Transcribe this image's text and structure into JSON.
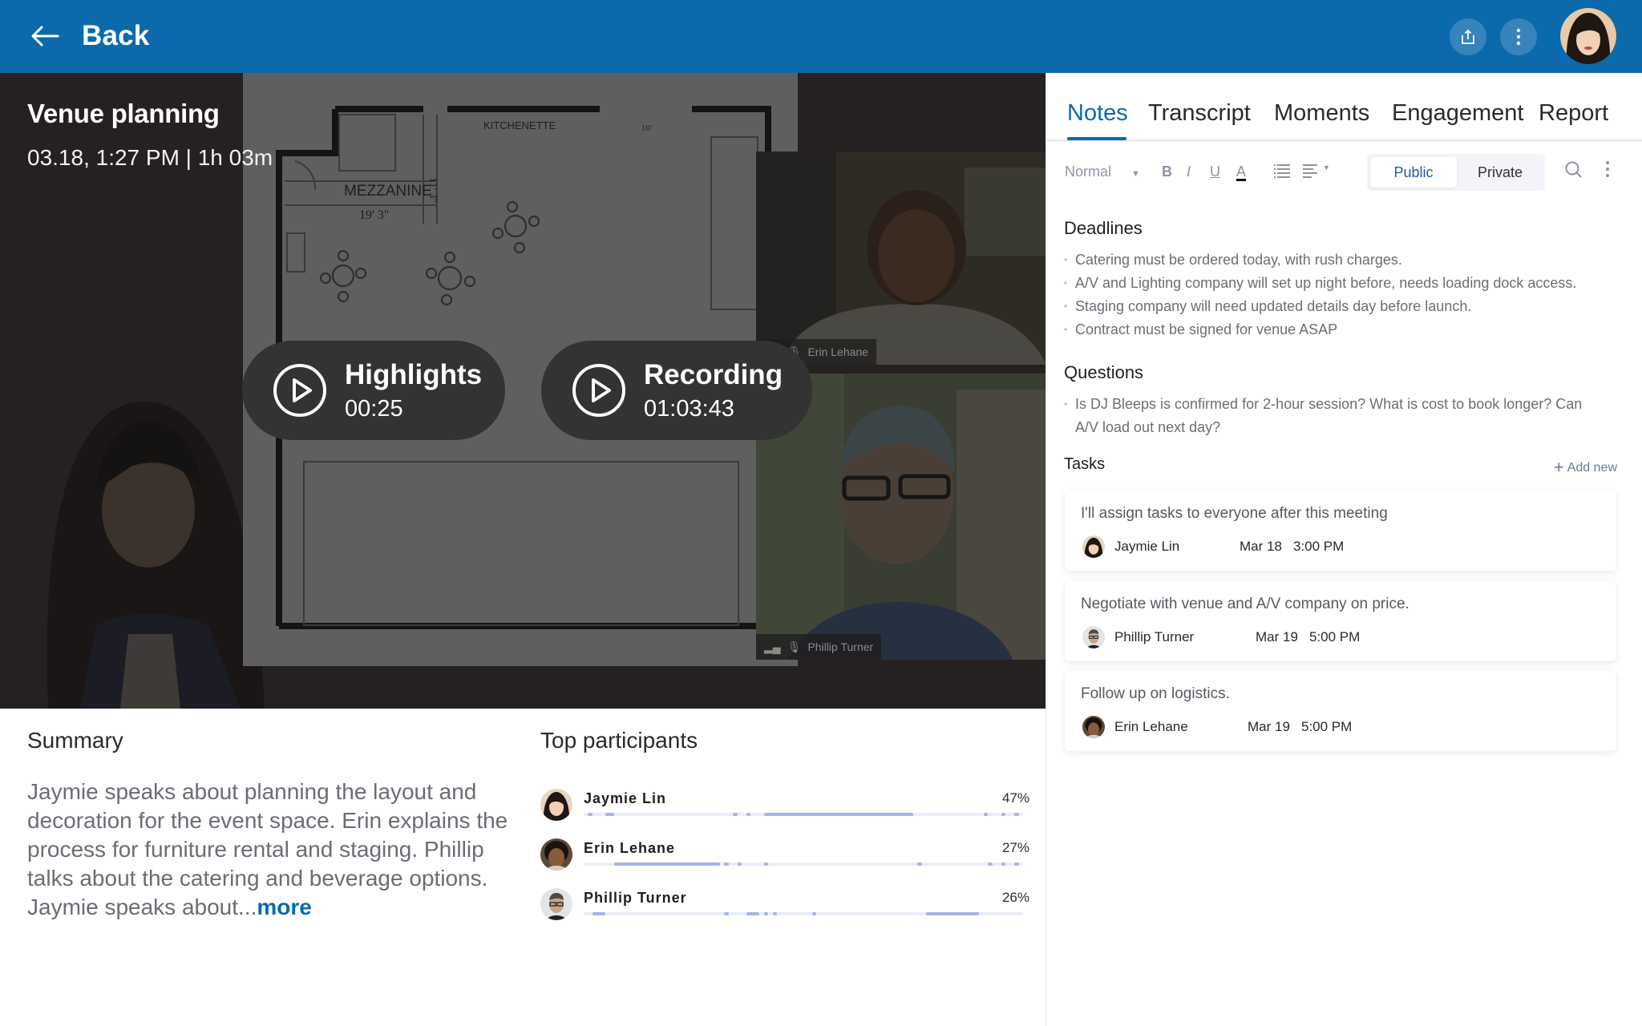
{
  "header": {
    "back_label": "Back",
    "brand_color": "#0a6aab",
    "actions": [
      {
        "icon": "share-icon"
      },
      {
        "icon": "more-vertical-icon"
      }
    ],
    "user_avatar": "user-avatar"
  },
  "meeting": {
    "title": "Venue planning",
    "subtitle": "03.18, 1:27 PM | 1h 03m",
    "highlights": {
      "label": "Highlights",
      "duration": "00:25"
    },
    "recording": {
      "label": "Recording",
      "duration": "01:03:43"
    },
    "floor_plan_labels": {
      "kitchenette": "KITCHENETTE",
      "mezzanine": "MEZZANINE",
      "width_dim": "19' 3\"",
      "height_dim": "11' 3\"",
      "ten_ft": "10'"
    },
    "video_tiles": [
      {
        "name": "Erin Lehane"
      },
      {
        "name": "Phillip Turner"
      }
    ]
  },
  "summary": {
    "heading": "Summary",
    "text": "Jaymie speaks about planning the layout and decoration for the event space. Erin explains the process for furniture rental and staging. Phillip talks about the catering and beverage options. Jaymie speaks about...",
    "more_label": "more"
  },
  "participants": {
    "heading": "Top participants",
    "items": [
      {
        "name": "Jaymie Lin",
        "percent": "47%",
        "share": 0.47,
        "segments": [
          [
            0.01,
            0.02
          ],
          [
            0.05,
            0.07
          ],
          [
            0.34,
            0.35
          ],
          [
            0.37,
            0.38
          ],
          [
            0.41,
            0.75
          ],
          [
            0.91,
            0.92
          ],
          [
            0.95,
            0.96
          ],
          [
            0.98,
            0.99
          ]
        ]
      },
      {
        "name": "Erin Lehane",
        "percent": "27%",
        "share": 0.27,
        "segments": [
          [
            0.07,
            0.31
          ],
          [
            0.32,
            0.33
          ],
          [
            0.35,
            0.36
          ],
          [
            0.41,
            0.42
          ],
          [
            0.76,
            0.77
          ],
          [
            0.92,
            0.93
          ],
          [
            0.95,
            0.96
          ],
          [
            0.98,
            0.99
          ]
        ]
      },
      {
        "name": "Phillip Turner",
        "percent": "26%",
        "share": 0.26,
        "segments": [
          [
            0.02,
            0.05
          ],
          [
            0.32,
            0.33
          ],
          [
            0.37,
            0.4
          ],
          [
            0.41,
            0.42
          ],
          [
            0.43,
            0.44
          ],
          [
            0.52,
            0.53
          ],
          [
            0.78,
            0.9
          ]
        ]
      }
    ]
  },
  "tabs": [
    {
      "label": "Notes",
      "active": true
    },
    {
      "label": "Transcript",
      "active": false
    },
    {
      "label": "Moments",
      "active": false
    },
    {
      "label": "Engagement",
      "active": false
    },
    {
      "label": "Report",
      "active": false
    }
  ],
  "toolbar": {
    "style_select": "Normal",
    "bold": "B",
    "italic": "I",
    "underline": "U",
    "text_color": "A",
    "visibility_options": [
      "Public",
      "Private"
    ],
    "visibility_selected": "Public"
  },
  "notes": {
    "deadlines": {
      "heading": "Deadlines",
      "items": [
        "Catering must be ordered today, with rush charges.",
        "A/V and Lighting company will set up night before, needs loading dock access.",
        "Staging company will need updated details day before launch.",
        "Contract must be signed for venue ASAP"
      ]
    },
    "questions": {
      "heading": "Questions",
      "items": [
        "Is DJ Bleeps is confirmed for 2-hour session? What is cost to book longer? Can A/V load out next day?"
      ]
    }
  },
  "tasks": {
    "heading": "Tasks",
    "add_label": "Add new",
    "items": [
      {
        "text": "I'll assign tasks to everyone after this meeting",
        "assignee": "Jaymie Lin",
        "date": "Mar 18",
        "time": "3:00 PM"
      },
      {
        "text": "Negotiate with venue and A/V company on price.",
        "assignee": "Phillip Turner",
        "date": "Mar 19",
        "time": "5:00 PM"
      },
      {
        "text": "Follow up on logistics.",
        "assignee": "Erin Lehane",
        "date": "Mar 19",
        "time": "5:00 PM"
      }
    ]
  }
}
